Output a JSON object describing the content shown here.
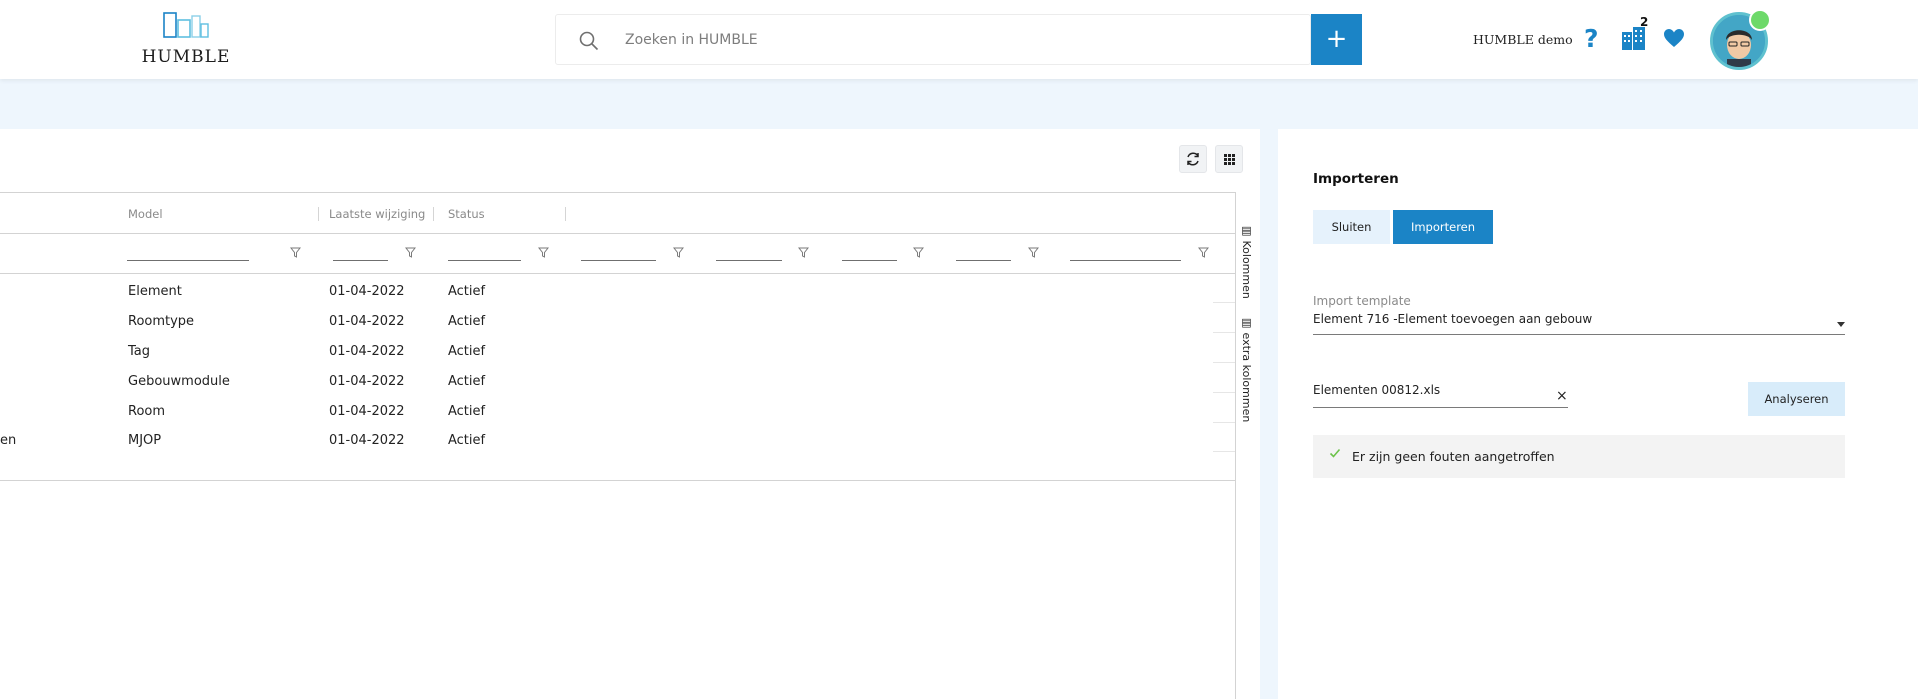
{
  "header": {
    "logo_text": "HUMBLE",
    "search_placeholder": "Zoeken in HUMBLE",
    "add_label": "+",
    "user_label": "HUMBLE demo",
    "help_label": "?",
    "buildings_count": "2",
    "colors": {
      "accent": "#1b84c6",
      "notification": "#6dd96a"
    }
  },
  "grid": {
    "columns": [
      "Model",
      "Laatste wijziging",
      "Status"
    ],
    "rows": [
      {
        "prefix": "",
        "model": "Element",
        "date": "01-04-2022",
        "status": "Actief"
      },
      {
        "prefix": "",
        "model": "Roomtype",
        "date": "01-04-2022",
        "status": "Actief"
      },
      {
        "prefix": "",
        "model": "Tag",
        "date": "01-04-2022",
        "status": "Actief"
      },
      {
        "prefix": "",
        "model": "Gebouwmodule",
        "date": "01-04-2022",
        "status": "Actief"
      },
      {
        "prefix": "",
        "model": "Room",
        "date": "01-04-2022",
        "status": "Actief"
      },
      {
        "prefix": "en",
        "model": "MJOP",
        "date": "01-04-2022",
        "status": "Actief"
      }
    ],
    "side_tabs": [
      "Kolommen",
      "extra kolommen"
    ]
  },
  "import": {
    "title": "Importeren",
    "close_label": "Sluiten",
    "import_label": "Importeren",
    "template_label": "Import template",
    "template_value": "Element 716 -Element toevoegen aan gebouw",
    "file_value": "Elementen 00812.xls",
    "clear_label": "×",
    "analyse_label": "Analyseren",
    "message": "Er zijn geen fouten aangetroffen"
  }
}
